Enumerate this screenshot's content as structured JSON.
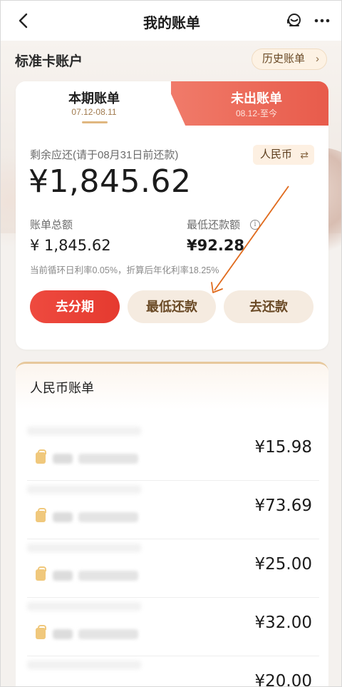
{
  "nav": {
    "title": "我的账单"
  },
  "account": {
    "title": "标准卡账户",
    "history_label": "历史账单",
    "history_chevron": "›"
  },
  "bill_card": {
    "tabs": [
      {
        "label": "本期账单",
        "dates": "07.12-08.11"
      },
      {
        "label": "未出账单",
        "dates": "08.12-至今"
      }
    ],
    "due_label": "剩余应还(请于08月31日前还款)",
    "currency": {
      "label": "人民币",
      "swap_symbol": "⇄"
    },
    "remaining_amount": "¥1,845.62",
    "total_label": "账单总额",
    "total_value": "¥ 1,845.62",
    "min_label": "最低还款额",
    "min_value": "¥92.28",
    "rate_note": "当前循环日利率0.05%，折算后年化利率18.25%",
    "buttons": {
      "installment": "去分期",
      "min_payment": "最低还款",
      "repay": "去还款"
    }
  },
  "transactions": {
    "title": "人民币账单",
    "items": [
      {
        "amount": "¥15.98"
      },
      {
        "amount": "¥73.69"
      },
      {
        "amount": "¥25.00"
      },
      {
        "amount": "¥32.00"
      },
      {
        "amount": "¥20.00"
      }
    ]
  },
  "colors": {
    "accent_red": "#e53a2f",
    "gold": "#a07a4e",
    "annotation_arrow": "#e06a1c"
  }
}
